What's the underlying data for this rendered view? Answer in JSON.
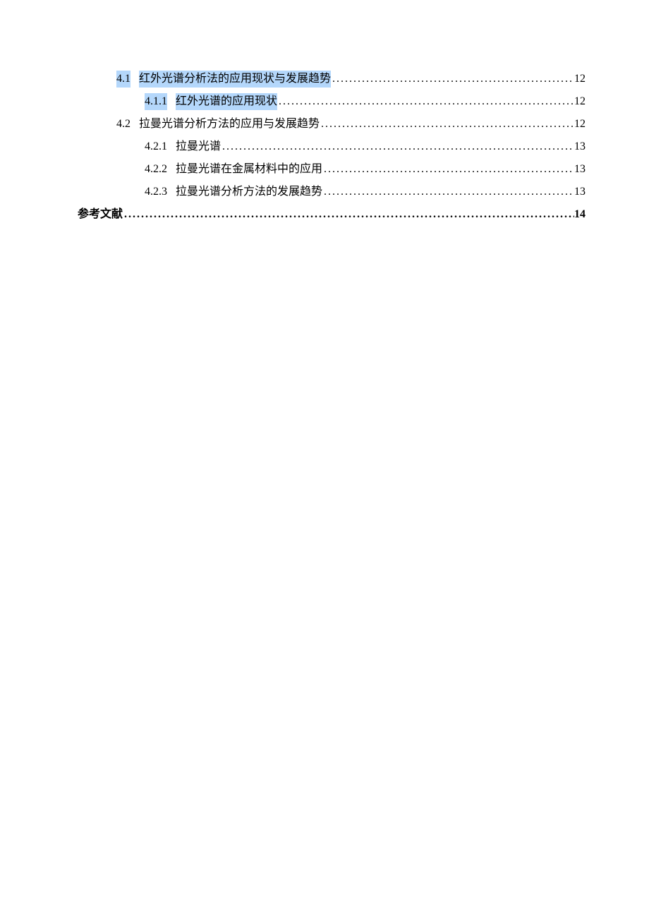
{
  "toc": {
    "items": [
      {
        "level": 2,
        "num": "4.1",
        "title": "红外光谱分析法的应用现状与发展趋势",
        "page": "12",
        "highlight": true
      },
      {
        "level": 3,
        "num": "4.1.1",
        "title": "红外光谱的应用现状",
        "page": "12",
        "highlight": true
      },
      {
        "level": 2,
        "num": "4.2",
        "title": "拉曼光谱分析方法的应用与发展趋势",
        "page": "12",
        "highlight": false
      },
      {
        "level": 3,
        "num": "4.2.1",
        "title": "拉曼光谱",
        "page": "13",
        "highlight": false
      },
      {
        "level": 3,
        "num": "4.2.2",
        "title": "拉曼光谱在金属材料中的应用",
        "page": "13",
        "highlight": false
      },
      {
        "level": 3,
        "num": "4.2.3",
        "title": "拉曼光谱分析方法的发展趋势",
        "page": "13",
        "highlight": false
      },
      {
        "level": 1,
        "num": "",
        "title": "参考文献",
        "page": "14",
        "highlight": false
      }
    ]
  }
}
